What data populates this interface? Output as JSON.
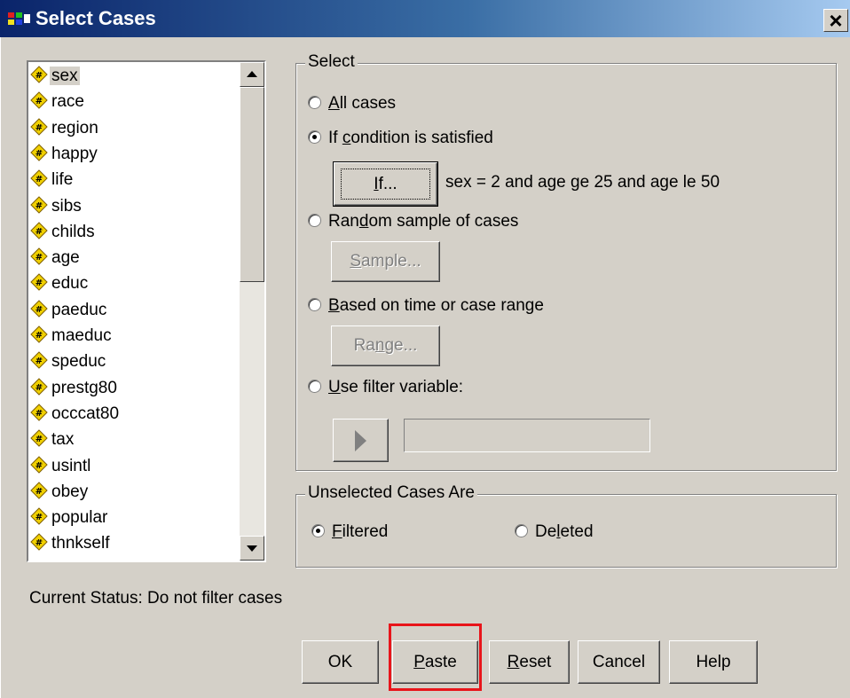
{
  "window": {
    "title": "Select Cases",
    "close_icon": "close-icon",
    "app_icon": "spss-icon"
  },
  "variables": [
    "sex",
    "race",
    "region",
    "happy",
    "life",
    "sibs",
    "childs",
    "age",
    "educ",
    "paeduc",
    "maeduc",
    "speduc",
    "prestg80",
    "occcat80",
    "tax",
    "usintl",
    "obey",
    "popular",
    "thnkself"
  ],
  "selected_variable": "sex",
  "select_group": {
    "legend": "Select",
    "options": [
      {
        "pre": "",
        "u": "A",
        "post": "ll cases",
        "checked": false
      },
      {
        "pre": "If ",
        "u": "c",
        "post": "ondition is satisfied",
        "checked": true
      },
      {
        "pre": "Ran",
        "u": "d",
        "post": "om sample of cases",
        "checked": false
      },
      {
        "pre": "",
        "u": "B",
        "post": "ased on time or case range",
        "checked": false
      },
      {
        "pre": "",
        "u": "U",
        "post": "se filter variable:",
        "checked": false
      }
    ],
    "if_button": {
      "u": "I",
      "post": "f..."
    },
    "condition": "sex = 2 and age ge 25 and age le 50",
    "sample_button": {
      "u": "S",
      "post": "ample..."
    },
    "range_button": {
      "pre": "Ra",
      "u": "n",
      "post": "ge..."
    },
    "filter_value": ""
  },
  "unselected_group": {
    "legend": "Unselected Cases Are",
    "filtered": {
      "u": "F",
      "post": "iltered",
      "checked": true
    },
    "deleted": {
      "pre": "De",
      "u": "l",
      "post": "eted",
      "checked": false
    }
  },
  "status": "Current Status: Do not filter cases",
  "buttons": {
    "ok": "OK",
    "paste": {
      "u": "P",
      "post": "aste"
    },
    "reset": {
      "u": "R",
      "post": "eset"
    },
    "cancel": "Cancel",
    "help": "Help"
  },
  "colors": {
    "highlight": "#e8141a",
    "title_start": "#0a246a",
    "title_end": "#a6caf0",
    "dialog_bg": "#d4d0c8"
  }
}
